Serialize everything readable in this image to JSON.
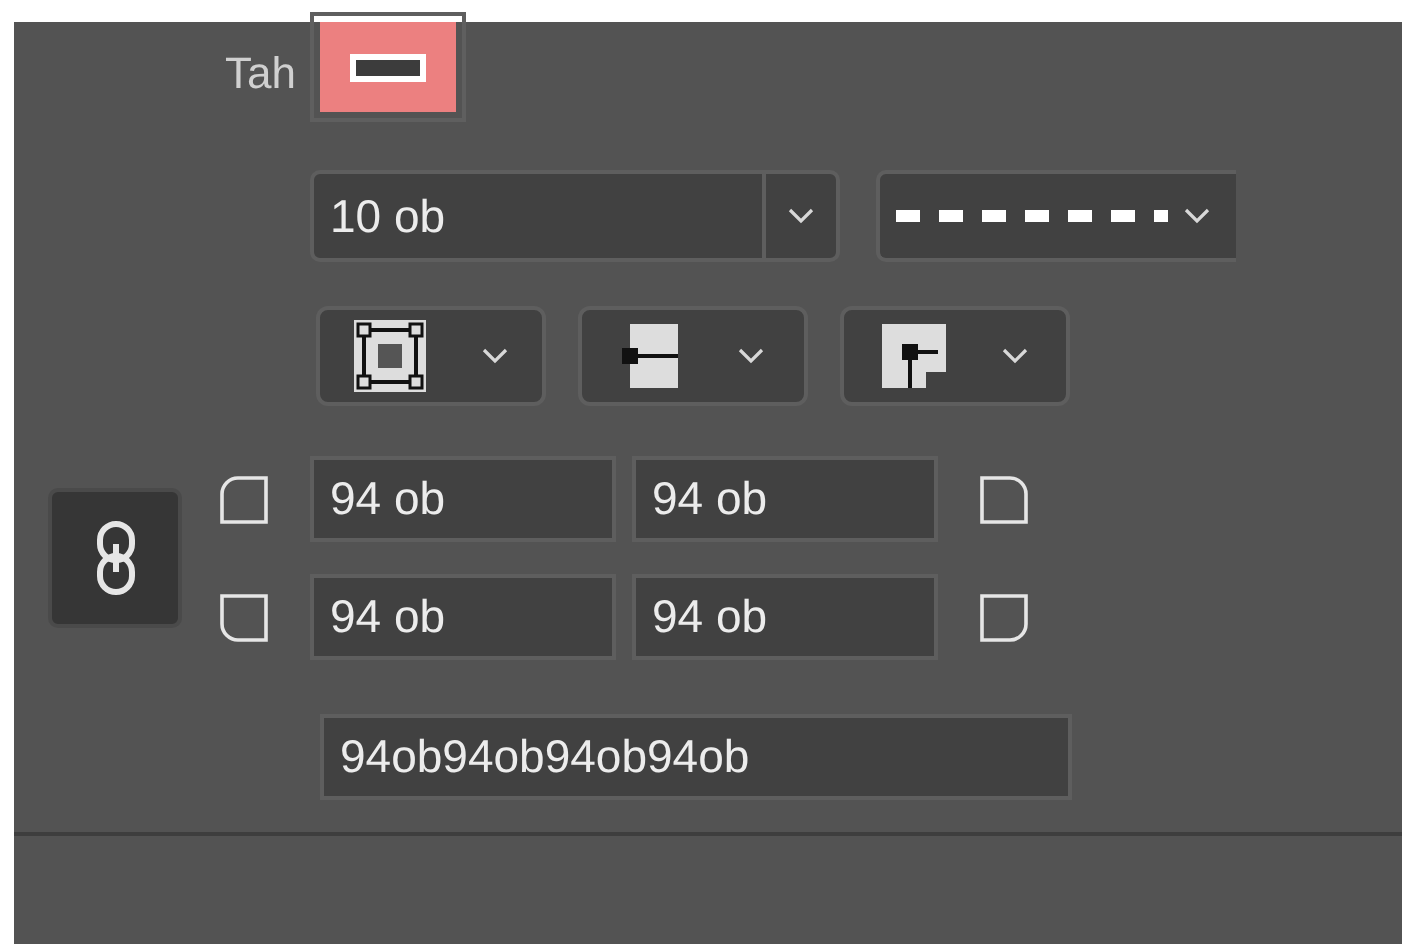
{
  "stroke": {
    "label": "Tah",
    "width": "10 ob"
  },
  "corners": {
    "top_left": "94 ob",
    "top_right": "94 ob",
    "bottom_left": "94 ob",
    "bottom_right": "94 ob",
    "combined": "94ob94ob94ob94ob"
  }
}
